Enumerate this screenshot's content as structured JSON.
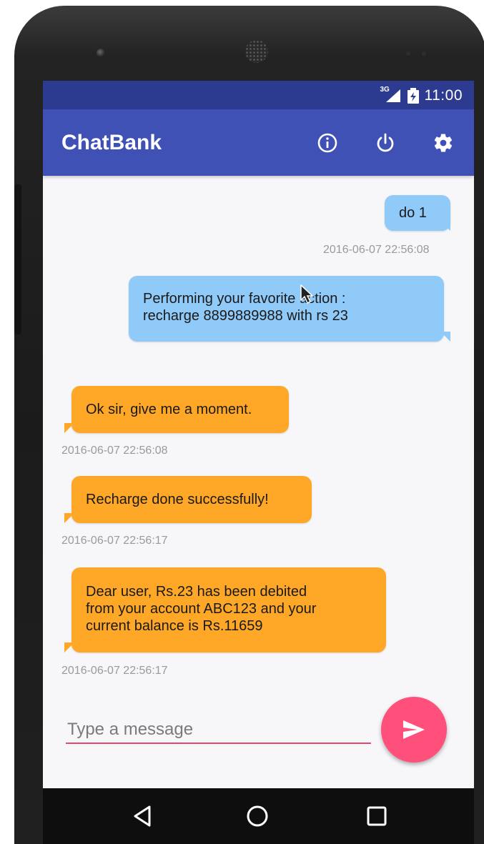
{
  "status_bar": {
    "network": "3G",
    "time": "11:00"
  },
  "app_bar": {
    "title": "ChatBank",
    "icons": [
      "info-icon",
      "power-icon",
      "settings-icon"
    ]
  },
  "messages": [
    {
      "direction": "outgoing",
      "text": "do 1",
      "timestamp": "2016-06-07 22:56:08"
    },
    {
      "direction": "outgoing",
      "text": "Performing your favorite action :\nrecharge 8899889988 with rs 23",
      "timestamp": ""
    },
    {
      "direction": "incoming",
      "text": "Ok sir, give me a moment.",
      "timestamp": "2016-06-07 22:56:08"
    },
    {
      "direction": "incoming",
      "text": "Recharge done successfully!",
      "timestamp": "2016-06-07 22:56:17"
    },
    {
      "direction": "incoming",
      "text": "Dear user, Rs.23 has been debited\nfrom your account ABC123 and your\ncurrent balance is Rs.11659",
      "timestamp": "2016-06-07 22:56:17"
    }
  ],
  "composer": {
    "placeholder": "Type a message",
    "value": ""
  },
  "colors": {
    "status_bar": "#2c3b8f",
    "app_bar": "#3f51b5",
    "outgoing_bubble": "#90caf9",
    "incoming_bubble": "#ffa726",
    "accent": "#ff4f7b"
  }
}
